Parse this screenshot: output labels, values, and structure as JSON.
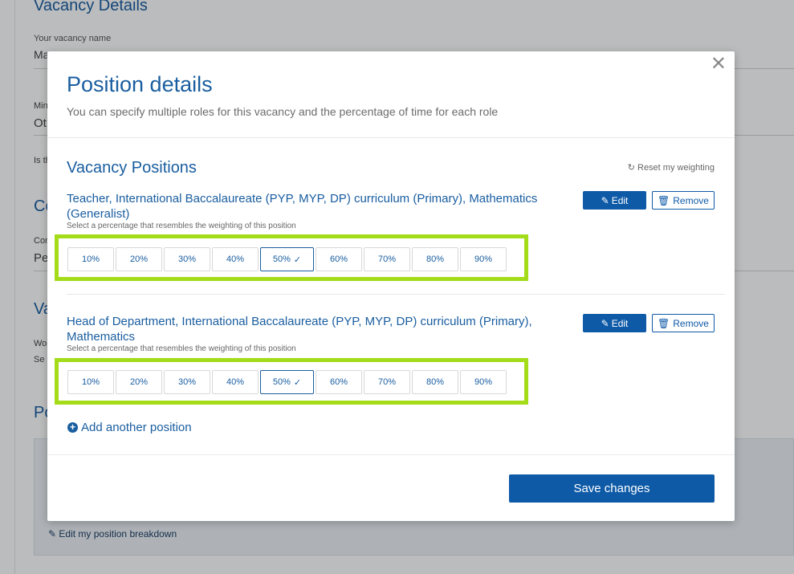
{
  "background": {
    "title": "Vacancy Details",
    "vacancy_name_label": "Your vacancy name",
    "vacancy_name_value": "Ma",
    "frag_mi": "Min",
    "frag_ot": "Ot",
    "frag_is": "Is th",
    "frag_co": "Co",
    "frag_cor": "Con",
    "frag_pe": "Pe",
    "frag_va": "Va",
    "frag_wo": "Wo",
    "frag_se": "Se",
    "frag_po": "Po",
    "edit_breakdown": "Edit my position breakdown"
  },
  "modal": {
    "close_icon": "close-icon",
    "title": "Position details",
    "subtitle": "You can specify multiple roles for this vacancy and the percentage of time for each role",
    "section_title": "Vacancy Positions",
    "reset_label": "Reset my weighting",
    "hint": "Select a percentage that resembles the weighting of this position",
    "edit_label": "Edit",
    "remove_label": "Remove",
    "positions": [
      {
        "title": "Teacher, International Baccalaureate (PYP, MYP, DP) curriculum (Primary), Mathematics (Generalist)",
        "selected": "50%"
      },
      {
        "title": "Head of Department, International Baccalaureate (PYP, MYP, DP) curriculum (Primary), Mathematics",
        "selected": "50%"
      }
    ],
    "percentages": [
      "10%",
      "20%",
      "30%",
      "40%",
      "50%",
      "60%",
      "70%",
      "80%",
      "90%"
    ],
    "add_label": "Add another position",
    "save_label": "Save changes"
  },
  "colors": {
    "accent": "#1a5ea0",
    "primary_button": "#0e5aa7",
    "highlight": "#a4dc1a"
  }
}
